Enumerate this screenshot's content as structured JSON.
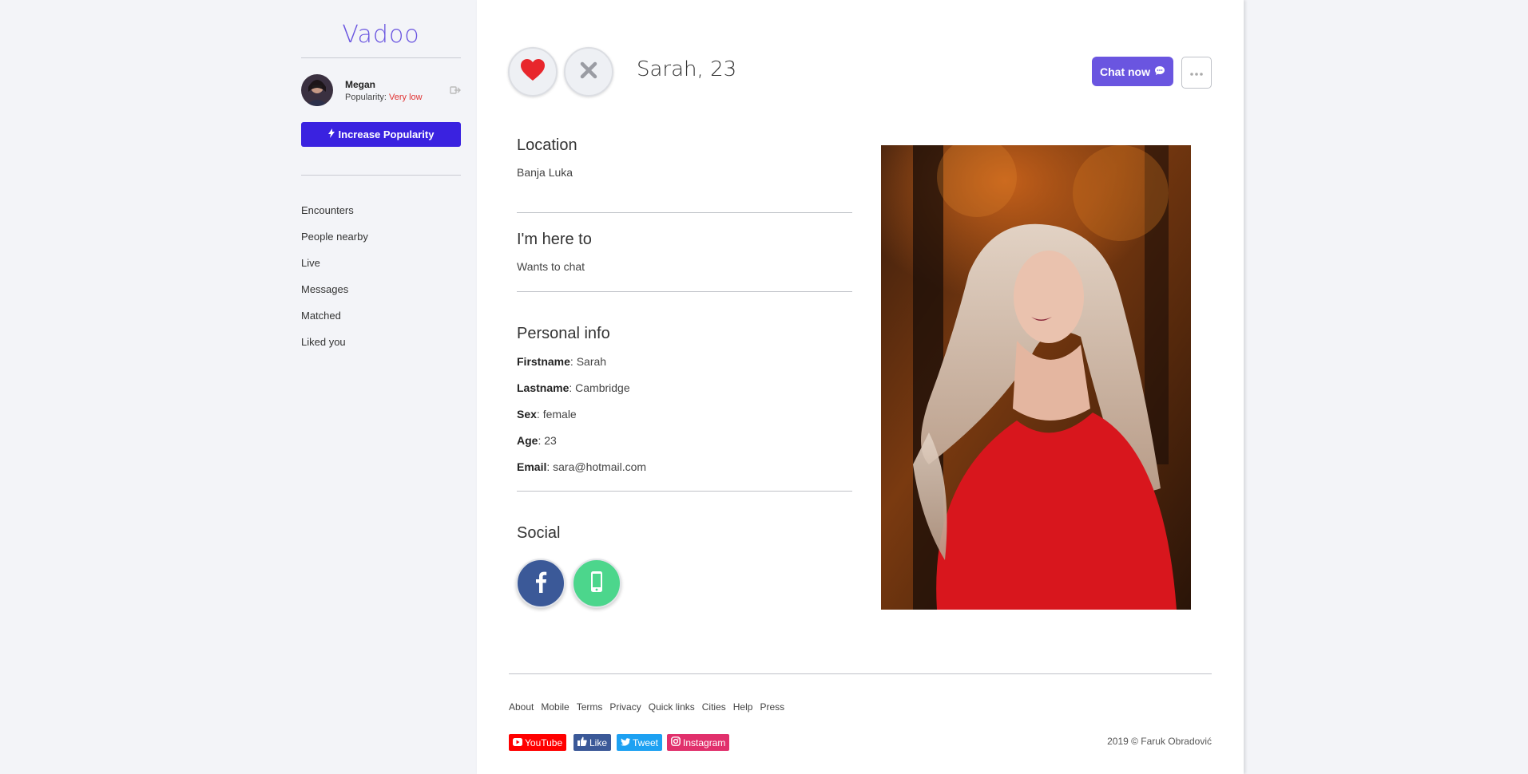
{
  "brand": {
    "logo": "Vadoo"
  },
  "user": {
    "name": "Megan",
    "popularity_label": "Popularity:",
    "popularity_value": "Very low",
    "popularity_color": "#e03131"
  },
  "sidebar": {
    "increase_btn": "Increase Popularity",
    "nav": [
      "Encounters",
      "People nearby",
      "Live",
      "Messages",
      "Matched",
      "Liked you"
    ]
  },
  "profile": {
    "title": "Sarah, 23",
    "chat_btn": "Chat now",
    "location": {
      "title": "Location",
      "value": "Banja Luka"
    },
    "here_to": {
      "title": "I'm here to",
      "value": "Wants to chat"
    },
    "personal": {
      "title": "Personal info",
      "rows": [
        {
          "label": "Firstname",
          "value": ": Sarah"
        },
        {
          "label": "Lastname",
          "value": ": Cambridge"
        },
        {
          "label": "Sex",
          "value": ": female"
        },
        {
          "label": "Age",
          "value": ": 23"
        },
        {
          "label": "Email",
          "value": ": sara@hotmail.com"
        }
      ]
    },
    "social_title": "Social"
  },
  "footer": {
    "links": [
      "About",
      "Mobile",
      "Terms",
      "Privacy",
      "Quick links",
      "Cities",
      "Help",
      "Press"
    ],
    "share": {
      "youtube": "YouTube",
      "like": "Like",
      "tweet": "Tweet",
      "instagram": "Instagram"
    },
    "copyright": "2019 © Faruk Obradović"
  },
  "colors": {
    "accent": "#6a55e0",
    "button": "#3a22e0",
    "facebook": "#3b5998",
    "phone": "#4cd68c",
    "youtube": "#ff0000",
    "twitter": "#1da1f2",
    "instagram": "#e1306c"
  }
}
